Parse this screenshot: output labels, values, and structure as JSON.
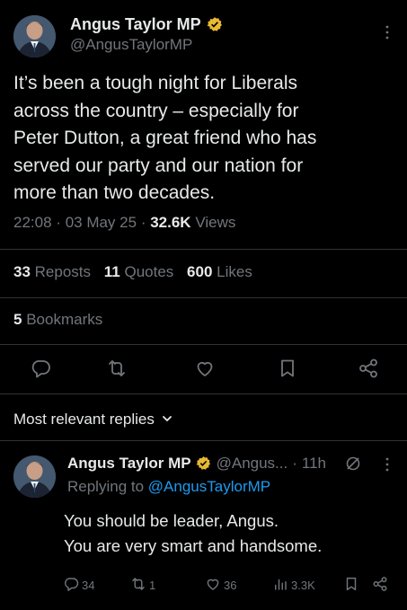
{
  "tweet": {
    "author_name": "Angus Taylor MP",
    "author_handle": "@AngusTaylorMP",
    "text_lines": [
      "It’s been a tough night for Liberals",
      "across the country – especially for",
      "Peter Dutton, a great friend who has",
      "served our party and our nation for",
      "more than two decades."
    ],
    "time": "22:08",
    "sep": "·",
    "date": "03 May 25",
    "views_count": "32.6K",
    "views_label": "Views"
  },
  "stats": {
    "reposts_count": "33",
    "reposts_label": "Reposts",
    "quotes_count": "11",
    "quotes_label": "Quotes",
    "likes_count": "600",
    "likes_label": "Likes",
    "bookmarks_count": "5",
    "bookmarks_label": "Bookmarks"
  },
  "replies_filter": {
    "label": "Most relevant replies"
  },
  "reply": {
    "author_name": "Angus Taylor MP",
    "author_handle": "@Angus...",
    "sep": "·",
    "time": "11h",
    "replying_prefix": "Replying to",
    "replying_handle": "@AngusTaylorMP",
    "text_lines": [
      "You should be leader, Angus.",
      "You are very smart and handsome."
    ],
    "actions": {
      "replies": "34",
      "reposts": "1",
      "likes": "36",
      "views": "3.3K"
    }
  },
  "colors": {
    "background": "#000000",
    "text": "#e7e9ea",
    "muted": "#71767b",
    "link": "#1d9bf0",
    "verified_badge": "#e8b931",
    "divider": "#2f3336"
  },
  "icons": [
    "gold-verified-badge",
    "more-icon",
    "reply-icon",
    "repost-icon",
    "like-icon",
    "bookmark-icon",
    "share-icon",
    "chevron-down-icon",
    "views-icon",
    "grok-icon"
  ]
}
